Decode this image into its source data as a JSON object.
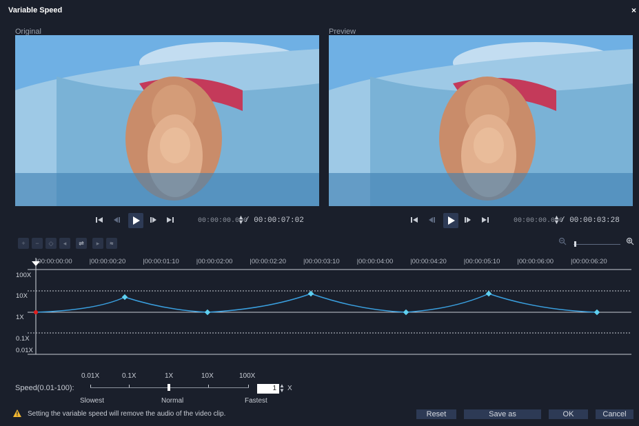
{
  "window": {
    "title": "Variable Speed",
    "close_label": "×"
  },
  "original": {
    "label": "Original",
    "timecode": "00:00:00.000",
    "total": "/ 00:00:07:02"
  },
  "preview": {
    "label": "Preview",
    "timecode": "00:00:00.000",
    "total": "/ 00:00:03:28"
  },
  "ruler": {
    "ticks": [
      "00:00:00:00",
      "00:00:00:20",
      "00:00:01:10",
      "00:00:02:00",
      "00:00:02:20",
      "00:00:03:10",
      "00:00:04:00",
      "00:00:04:20",
      "00:00:05:10",
      "00:00:06:00",
      "00:00:06:20"
    ]
  },
  "graph": {
    "levels": [
      "100X",
      "10X",
      "1X",
      "0.1X",
      "0.01X"
    ]
  },
  "speed": {
    "label": "Speed(0.01-100):",
    "tick_labels": [
      "0.01X",
      "0.1X",
      "1X",
      "10X",
      "100X"
    ],
    "bottom_labels": [
      "Slowest",
      "Normal",
      "Fastest"
    ],
    "value": "1",
    "unit": "X"
  },
  "footer": {
    "warning": "Setting the variable speed will remove the audio of the video clip.",
    "buttons": {
      "reset": "Reset",
      "save_as": "Save as",
      "ok": "OK",
      "cancel": "Cancel"
    }
  },
  "colors": {
    "background": "#1a1f2b",
    "accent": "#3aa0e0",
    "button": "#2d3a55",
    "keyframe_start": "#e02020"
  },
  "icons": [
    "warning-icon",
    "zoom-out-icon",
    "zoom-in-icon",
    "play-icon",
    "go-to-start-icon",
    "go-to-end-icon",
    "previous-frame-icon",
    "next-frame-icon"
  ]
}
